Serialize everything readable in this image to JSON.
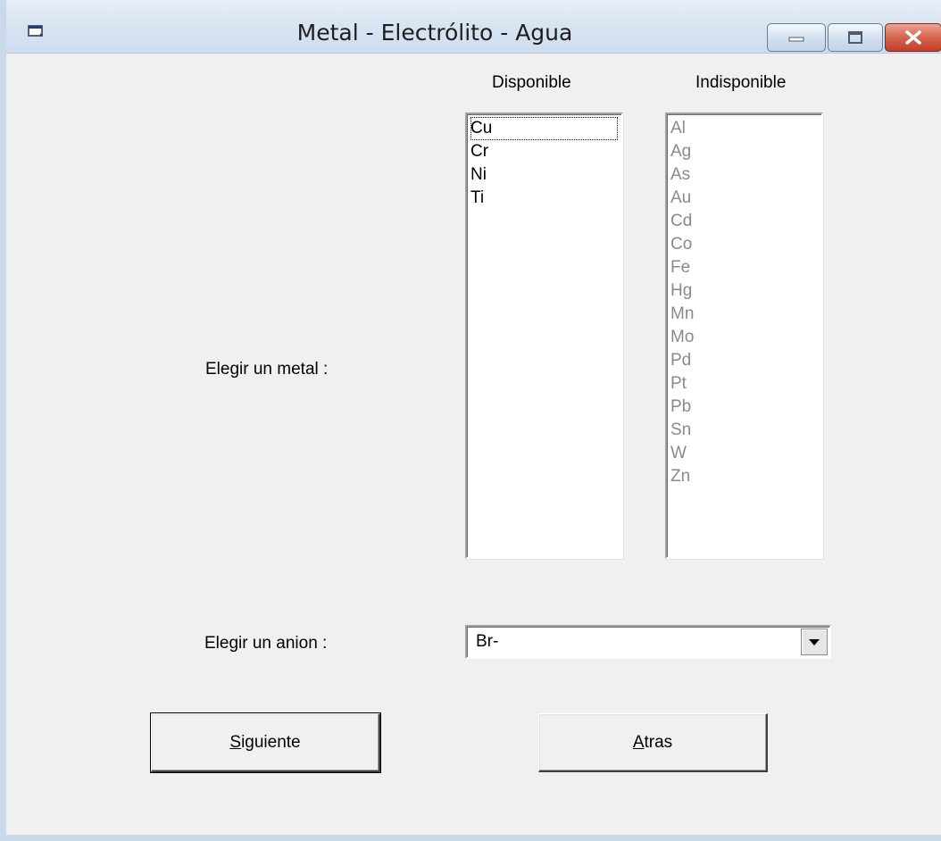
{
  "window": {
    "title": "Metal - Electrólito - Agua",
    "controls": {
      "minimize": "minimize-icon",
      "maximize": "maximize-icon",
      "close": "close-icon"
    }
  },
  "columns": {
    "available_header": "Disponible",
    "unavailable_header": "Indisponible"
  },
  "metal": {
    "label": "Elegir un metal :",
    "available": [
      "Cu",
      "Cr",
      "Ni",
      "Ti"
    ],
    "unavailable": [
      "Al",
      "Ag",
      "As",
      "Au",
      "Cd",
      "Co",
      "Fe",
      "Hg",
      "Mn",
      "Mo",
      "Pd",
      "Pt",
      "Pb",
      "Sn",
      "W",
      "Zn"
    ]
  },
  "anion": {
    "label": "Elegir un anion :",
    "selected": "Br-"
  },
  "buttons": {
    "next_mnemonic": "S",
    "next_rest": "iguiente",
    "back_mnemonic": "A",
    "back_rest": "tras"
  }
}
